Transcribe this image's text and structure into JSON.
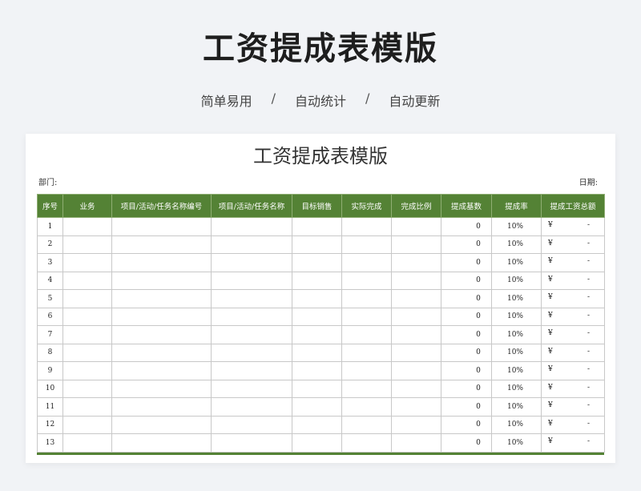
{
  "hero": {
    "title": "工资提成表模版",
    "features": [
      "简单易用",
      "自动统计",
      "自动更新"
    ],
    "separator": "/"
  },
  "sheet": {
    "title": "工资提成表模版",
    "department_label": "部门:",
    "date_label": "日期:",
    "header_color": "#548235",
    "columns": [
      "序号",
      "业务",
      "项目/活动/任务名称编号",
      "项目/活动/任务名称",
      "目标销售",
      "实际完成",
      "完成比例",
      "提成基数",
      "提成率",
      "提成工资总额"
    ],
    "rows": [
      {
        "no": "1",
        "base": "0",
        "rate": "10%",
        "currency": "¥",
        "total": "-"
      },
      {
        "no": "2",
        "base": "0",
        "rate": "10%",
        "currency": "¥",
        "total": "-"
      },
      {
        "no": "3",
        "base": "0",
        "rate": "10%",
        "currency": "¥",
        "total": "-"
      },
      {
        "no": "4",
        "base": "0",
        "rate": "10%",
        "currency": "¥",
        "total": "-"
      },
      {
        "no": "5",
        "base": "0",
        "rate": "10%",
        "currency": "¥",
        "total": "-"
      },
      {
        "no": "6",
        "base": "0",
        "rate": "10%",
        "currency": "¥",
        "total": "-"
      },
      {
        "no": "7",
        "base": "0",
        "rate": "10%",
        "currency": "¥",
        "total": "-"
      },
      {
        "no": "8",
        "base": "0",
        "rate": "10%",
        "currency": "¥",
        "total": "-"
      },
      {
        "no": "9",
        "base": "0",
        "rate": "10%",
        "currency": "¥",
        "total": "-"
      },
      {
        "no": "10",
        "base": "0",
        "rate": "10%",
        "currency": "¥",
        "total": "-"
      },
      {
        "no": "11",
        "base": "0",
        "rate": "10%",
        "currency": "¥",
        "total": "-"
      },
      {
        "no": "12",
        "base": "0",
        "rate": "10%",
        "currency": "¥",
        "total": "-"
      },
      {
        "no": "13",
        "base": "0",
        "rate": "10%",
        "currency": "¥",
        "total": "-"
      }
    ]
  }
}
